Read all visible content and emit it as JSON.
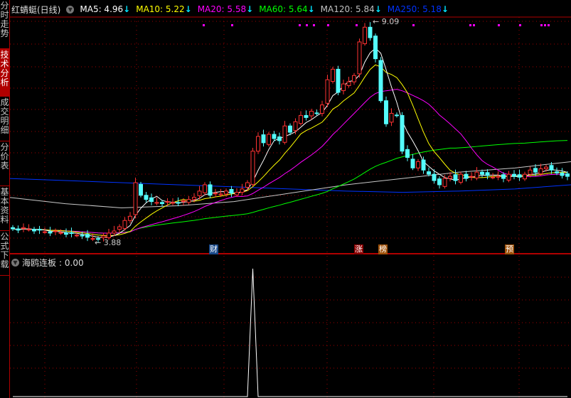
{
  "sidebar": {
    "tabs": [
      {
        "label": "分时走势"
      },
      {
        "label": "技术分析",
        "active": true
      },
      {
        "label": "成交明细"
      },
      {
        "label": "分价表"
      },
      {
        "label": "基本资料"
      },
      {
        "label": "公式下载"
      }
    ]
  },
  "header": {
    "title": "红蜻蜓(日线)",
    "ma": [
      {
        "label": "MA5: 4.96",
        "color": "#ffffff"
      },
      {
        "label": "MA10: 5.22",
        "color": "#ffff00"
      },
      {
        "label": "MA20: 5.58",
        "color": "#ff00ff"
      },
      {
        "label": "MA60: 5.64",
        "color": "#00ff00"
      },
      {
        "label": "MA120: 5.84",
        "color": "#c0c0c0"
      },
      {
        "label": "MA250: 5.18",
        "color": "#0033ff"
      }
    ],
    "arrow": "↓"
  },
  "markers": [
    {
      "label": "财",
      "color": "#1a4a8a"
    },
    {
      "label": "涨",
      "color": "#8b0000"
    },
    {
      "label": "榜",
      "color": "#a0520a"
    },
    {
      "label": "预",
      "color": "#a0520a"
    }
  ],
  "lower": {
    "title": "海鸥连板",
    "value": ": 0.00"
  },
  "chart_data": {
    "type": "candlestick",
    "title": "红蜻蜓(日线)",
    "ylim": [
      3.88,
      9.09
    ],
    "annotations": {
      "high": "9.09",
      "low": "3.88"
    },
    "close": [
      4.15,
      4.12,
      4.18,
      4.14,
      4.1,
      4.12,
      4.08,
      4.05,
      4.1,
      4.06,
      4.02,
      4.04,
      4.0,
      3.98,
      3.95,
      3.92,
      3.9,
      3.98,
      4.05,
      4.1,
      4.2,
      4.35,
      4.45,
      5.25,
      4.95,
      4.85,
      4.8,
      4.78,
      4.75,
      4.8,
      4.78,
      4.76,
      4.82,
      4.85,
      4.9,
      5.05,
      5.2,
      4.95,
      5.0,
      4.98,
      5.05,
      5.0,
      5.02,
      5.1,
      5.25,
      6.0,
      6.35,
      6.2,
      6.4,
      6.3,
      6.25,
      6.6,
      6.45,
      6.7,
      6.85,
      6.8,
      6.95,
      6.9,
      7.1,
      7.7,
      7.95,
      7.4,
      7.6,
      7.65,
      7.8,
      8.6,
      8.95,
      8.7,
      8.2,
      7.2,
      6.65,
      6.9,
      6.85,
      6.0,
      5.85,
      5.6,
      5.75,
      5.55,
      5.45,
      5.3,
      5.2,
      5.35,
      5.4,
      5.3,
      5.45,
      5.35,
      5.4,
      5.5,
      5.45,
      5.42,
      5.38,
      5.4,
      5.35,
      5.45,
      5.4,
      5.38,
      5.45,
      5.55,
      5.5,
      5.58,
      5.62,
      5.55,
      5.48,
      5.42,
      5.4
    ],
    "ma120_samples": [
      4.9,
      4.75,
      4.65,
      4.7,
      4.8,
      5.0,
      5.2,
      5.35,
      5.5,
      5.6,
      5.75
    ],
    "ma250_samples": [
      5.35,
      5.3,
      5.25,
      5.2,
      5.15,
      5.1,
      5.05,
      5.02,
      5.05,
      5.1,
      5.2
    ],
    "indicator": {
      "name": "海鸥连板",
      "spike_index": 45,
      "spike_value": 1,
      "current": 0.0
    }
  }
}
